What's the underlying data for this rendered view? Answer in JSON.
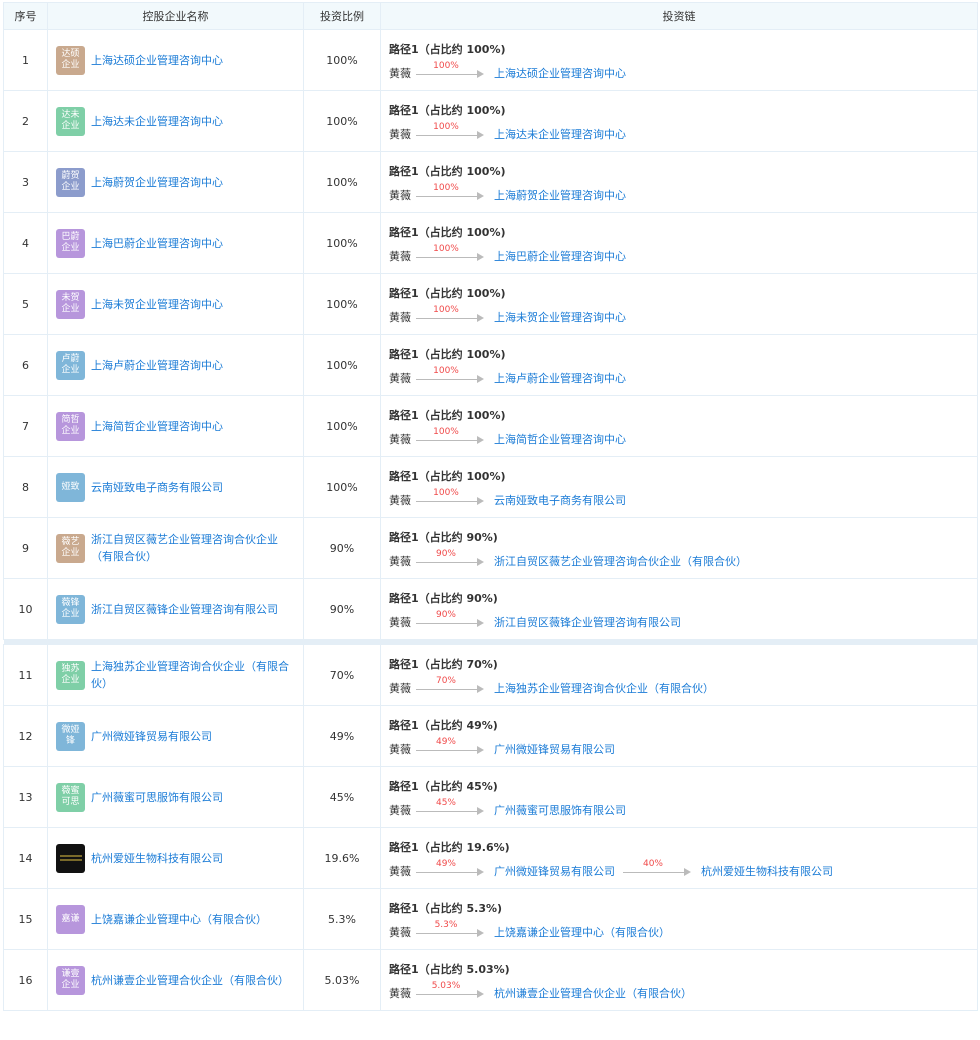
{
  "headers": {
    "idx": "序号",
    "name": "控股企业名称",
    "ratio": "投资比例",
    "chain": "投资链"
  },
  "holder": "黄薇",
  "rows": [
    {
      "idx": "1",
      "logo": [
        "达硕",
        "企业"
      ],
      "color": "#c9a98e",
      "name": "上海达硕企业管理咨询中心",
      "ratio": "100%",
      "path": "路径1（占比约 100%)",
      "links": [
        {
          "pct": "100%",
          "target": "上海达硕企业管理咨询中心"
        }
      ]
    },
    {
      "idx": "2",
      "logo": [
        "达未",
        "企业"
      ],
      "color": "#7fcfa7",
      "name": "上海达未企业管理咨询中心",
      "ratio": "100%",
      "path": "路径1（占比约 100%)",
      "links": [
        {
          "pct": "100%",
          "target": "上海达未企业管理咨询中心"
        }
      ]
    },
    {
      "idx": "3",
      "logo": [
        "蔚贺",
        "企业"
      ],
      "color": "#8c9ccc",
      "name": "上海蔚贺企业管理咨询中心",
      "ratio": "100%",
      "path": "路径1（占比约 100%)",
      "links": [
        {
          "pct": "100%",
          "target": "上海蔚贺企业管理咨询中心"
        }
      ]
    },
    {
      "idx": "4",
      "logo": [
        "巴蔚",
        "企业"
      ],
      "color": "#b796dc",
      "name": "上海巴蔚企业管理咨询中心",
      "ratio": "100%",
      "path": "路径1（占比约 100%)",
      "links": [
        {
          "pct": "100%",
          "target": "上海巴蔚企业管理咨询中心"
        }
      ]
    },
    {
      "idx": "5",
      "logo": [
        "未贺",
        "企业"
      ],
      "color": "#b796dc",
      "name": "上海未贺企业管理咨询中心",
      "ratio": "100%",
      "path": "路径1（占比约 100%)",
      "links": [
        {
          "pct": "100%",
          "target": "上海未贺企业管理咨询中心"
        }
      ]
    },
    {
      "idx": "6",
      "logo": [
        "卢蔚",
        "企业"
      ],
      "color": "#7fb6d9",
      "name": "上海卢蔚企业管理咨询中心",
      "ratio": "100%",
      "path": "路径1（占比约 100%)",
      "links": [
        {
          "pct": "100%",
          "target": "上海卢蔚企业管理咨询中心"
        }
      ]
    },
    {
      "idx": "7",
      "logo": [
        "简哲",
        "企业"
      ],
      "color": "#b796dc",
      "name": "上海简哲企业管理咨询中心",
      "ratio": "100%",
      "path": "路径1（占比约 100%)",
      "links": [
        {
          "pct": "100%",
          "target": "上海简哲企业管理咨询中心"
        }
      ]
    },
    {
      "idx": "8",
      "logo": [
        "娅致"
      ],
      "color": "#7fb6d9",
      "name": "云南娅致电子商务有限公司",
      "ratio": "100%",
      "path": "路径1（占比约 100%)",
      "links": [
        {
          "pct": "100%",
          "target": "云南娅致电子商务有限公司"
        }
      ]
    },
    {
      "idx": "9",
      "logo": [
        "薇艺",
        "企业"
      ],
      "color": "#c9a98e",
      "name": "浙江自贸区薇艺企业管理咨询合伙企业（有限合伙）",
      "ratio": "90%",
      "path": "路径1（占比约 90%)",
      "links": [
        {
          "pct": "90%",
          "target": "浙江自贸区薇艺企业管理咨询合伙企业（有限合伙）"
        }
      ]
    },
    {
      "idx": "10",
      "logo": [
        "薇锋",
        "企业"
      ],
      "color": "#7fb6d9",
      "name": "浙江自贸区薇锋企业管理咨询有限公司",
      "ratio": "90%",
      "path": "路径1（占比约 90%)",
      "links": [
        {
          "pct": "90%",
          "target": "浙江自贸区薇锋企业管理咨询有限公司"
        }
      ]
    },
    {
      "idx": "11",
      "logo": [
        "独苏",
        "企业"
      ],
      "color": "#7fcfa7",
      "name": "上海独苏企业管理咨询合伙企业（有限合伙）",
      "ratio": "70%",
      "path": "路径1（占比约 70%)",
      "links": [
        {
          "pct": "70%",
          "target": "上海独苏企业管理咨询合伙企业（有限合伙）"
        }
      ]
    },
    {
      "idx": "12",
      "logo": [
        "微娅",
        "锋"
      ],
      "color": "#7fb6d9",
      "name": "广州微娅锋贸易有限公司",
      "ratio": "49%",
      "path": "路径1（占比约 49%)",
      "links": [
        {
          "pct": "49%",
          "target": "广州微娅锋贸易有限公司"
        }
      ]
    },
    {
      "idx": "13",
      "logo": [
        "薇蜜",
        "可思"
      ],
      "color": "#7fcfa7",
      "name": "广州薇蜜可思服饰有限公司",
      "ratio": "45%",
      "path": "路径1（占比约 45%)",
      "links": [
        {
          "pct": "45%",
          "target": "广州薇蜜可思服饰有限公司"
        }
      ]
    },
    {
      "idx": "14",
      "logo": [],
      "color": "#111111",
      "dark": true,
      "name": "杭州爱娅生物科技有限公司",
      "ratio": "19.6%",
      "path": "路径1（占比约 19.6%)",
      "links": [
        {
          "pct": "49%",
          "target": "广州微娅锋贸易有限公司"
        },
        {
          "pct": "40%",
          "target": "杭州爱娅生物科技有限公司"
        }
      ]
    },
    {
      "idx": "15",
      "logo": [
        "嘉谦"
      ],
      "color": "#b796dc",
      "name": "上饶嘉谦企业管理中心（有限合伙）",
      "ratio": "5.3%",
      "path": "路径1（占比约 5.3%)",
      "links": [
        {
          "pct": "5.3%",
          "target": "上饶嘉谦企业管理中心（有限合伙）"
        }
      ]
    },
    {
      "idx": "16",
      "logo": [
        "谦壹",
        "企业"
      ],
      "color": "#b796dc",
      "name": "杭州谦壹企业管理合伙企业（有限合伙）",
      "ratio": "5.03%",
      "path": "路径1（占比约 5.03%)",
      "links": [
        {
          "pct": "5.03%",
          "target": "杭州谦壹企业管理合伙企业（有限合伙）"
        }
      ]
    }
  ]
}
